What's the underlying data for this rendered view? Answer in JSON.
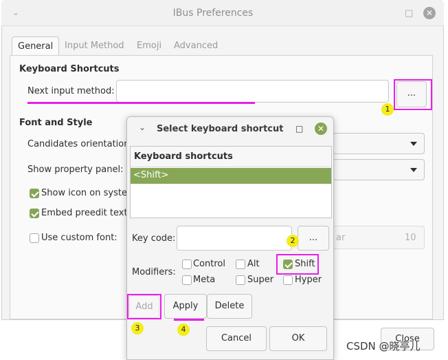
{
  "window": {
    "title": "IBus Preferences",
    "tabs": [
      {
        "label": "General",
        "active": true
      },
      {
        "label": "Input Method",
        "active": false
      },
      {
        "label": "Emoji",
        "active": false
      },
      {
        "label": "Advanced",
        "active": false
      }
    ]
  },
  "keyboard_shortcuts": {
    "section_title": "Keyboard Shortcuts",
    "next_input_label": "Next input method:",
    "next_input_value": "",
    "browse_button": "..."
  },
  "font_style": {
    "section_title": "Font and Style",
    "candidates_label": "Candidates orientation:",
    "property_panel_label": "Show property panel:",
    "show_icon_label": "Show icon on system",
    "embed_preedit_label": "Embed preedit text in",
    "custom_font_label": "Use custom font:",
    "font_name_partial": "ar",
    "font_size": "10"
  },
  "dialog": {
    "title": "Select keyboard shortcut for sw",
    "list_header": "Keyboard shortcuts",
    "list_items": [
      "<Shift>"
    ],
    "key_code_label": "Key code:",
    "key_code_value": "",
    "key_code_button": "...",
    "modifiers_label": "Modifiers:",
    "modifiers": {
      "control": {
        "label": "Control",
        "checked": false
      },
      "alt": {
        "label": "Alt",
        "checked": false
      },
      "shift": {
        "label": "Shift",
        "checked": true
      },
      "meta": {
        "label": "Meta",
        "checked": false
      },
      "super": {
        "label": "Super",
        "checked": false
      },
      "hyper": {
        "label": "Hyper",
        "checked": false
      }
    },
    "add_button": "Add",
    "apply_button": "Apply",
    "delete_button": "Delete",
    "cancel_button": "Cancel",
    "ok_button": "OK"
  },
  "main_close_button": "Close",
  "annotations": {
    "badge1": "1",
    "badge2": "2",
    "badge3": "3",
    "badge4": "4",
    "highlight_color": "#e81ee8",
    "badge_color": "#f4ec1c"
  },
  "watermark": "CSDN @晓亭儿",
  "colors": {
    "accent": "#87a556",
    "selection": "#88a756"
  }
}
